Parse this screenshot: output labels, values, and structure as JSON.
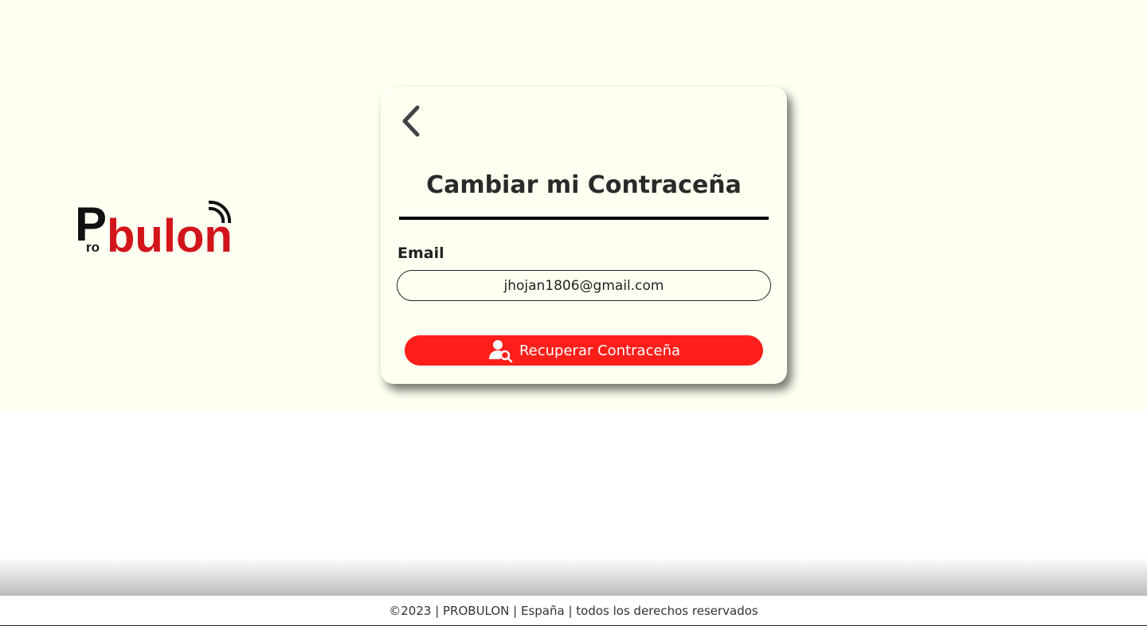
{
  "logo": {
    "text_pro": "ro",
    "text_p": "P",
    "text_bulon": "bulon",
    "brand_colors": {
      "dark": "#111111",
      "red": "#d2141b"
    }
  },
  "card": {
    "back_icon": "chevron-left-icon",
    "title": "Cambiar mi Contraceña",
    "email_label": "Email",
    "email_value": "jhojan1806@gmail.com",
    "submit_label": "Recuperar Contraceña",
    "submit_icon": "user-search-icon",
    "accent_color": "#fe1e1a"
  },
  "footer": {
    "text": "©2023 | PROBULON | España | todos los derechos reservados"
  }
}
